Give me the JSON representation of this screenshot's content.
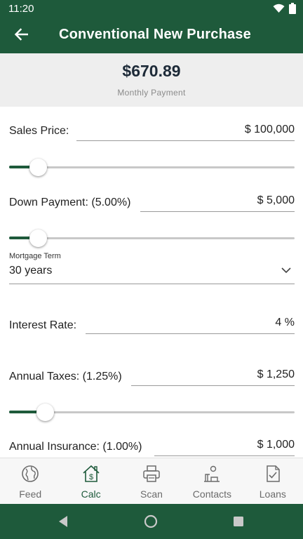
{
  "status_bar": {
    "time": "11:20"
  },
  "app_bar": {
    "title": "Conventional New Purchase"
  },
  "summary": {
    "amount": "$670.89",
    "label": "Monthly Payment"
  },
  "fields": {
    "sales_price": {
      "label": "Sales Price:",
      "value": "$ 100,000",
      "slider_fraction": 0.1
    },
    "down_payment": {
      "label": "Down Payment: (5.00%)",
      "value": "$ 5,000",
      "slider_fraction": 0.1
    },
    "mortgage_term": {
      "caption": "Mortgage Term",
      "value": "30 years"
    },
    "interest_rate": {
      "label": "Interest Rate:",
      "value": "4 %"
    },
    "annual_taxes": {
      "label": "Annual Taxes: (1.25%)",
      "value": "$ 1,250",
      "slider_fraction": 0.125
    },
    "annual_insurance": {
      "label": "Annual Insurance: (1.00%)",
      "value": "$ 1,000"
    }
  },
  "bottom_nav": {
    "items": [
      {
        "label": "Feed",
        "icon": "globe-icon"
      },
      {
        "label": "Calc",
        "icon": "house-dollar-icon",
        "active": true
      },
      {
        "label": "Scan",
        "icon": "printer-icon"
      },
      {
        "label": "Contacts",
        "icon": "contacts-icon"
      },
      {
        "label": "Loans",
        "icon": "document-check-icon"
      }
    ]
  },
  "colors": {
    "primary": "#1e5a3b",
    "summary_bg": "#eeeeee",
    "amount_text": "#1d2a38"
  }
}
